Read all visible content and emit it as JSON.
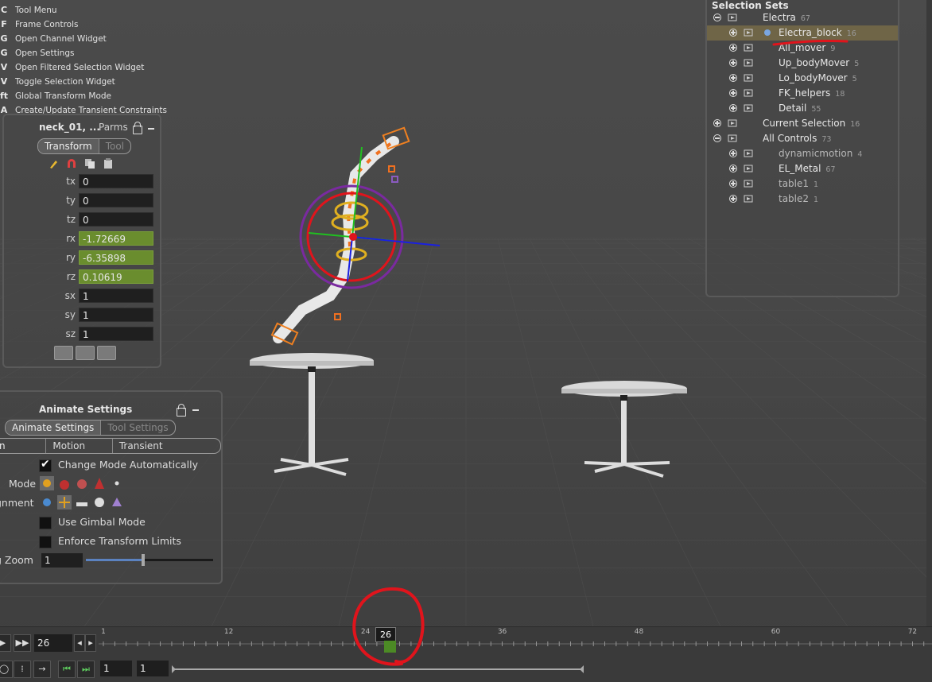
{
  "hotkeys": [
    {
      "key": "C",
      "label": "Tool Menu"
    },
    {
      "key": "F",
      "label": "Frame Controls"
    },
    {
      "key": "G",
      "label": "Open Channel Widget"
    },
    {
      "key": "G",
      "label": "Open Settings"
    },
    {
      "key": "V",
      "label": "Open Filtered Selection Widget"
    },
    {
      "key": "V",
      "label": "Toggle Selection Widget"
    },
    {
      "key": "ft",
      "label": "Global Transform Mode"
    },
    {
      "key": "A",
      "label": "Create/Update Transient Constraints"
    }
  ],
  "parms": {
    "title": "neck_01, ...",
    "subtitle": "Parms",
    "tabs": [
      "Transform",
      "Tool"
    ],
    "fields": [
      {
        "label": "tx",
        "value": "0",
        "keyed": false
      },
      {
        "label": "ty",
        "value": "0",
        "keyed": false
      },
      {
        "label": "tz",
        "value": "0",
        "keyed": false
      },
      {
        "label": "rx",
        "value": "-1.72669",
        "keyed": true
      },
      {
        "label": "ry",
        "value": "-6.35898",
        "keyed": true
      },
      {
        "label": "rz",
        "value": "0.10619",
        "keyed": true
      },
      {
        "label": "sx",
        "value": "1",
        "keyed": false
      },
      {
        "label": "sy",
        "value": "1",
        "keyed": false
      },
      {
        "label": "sz",
        "value": "1",
        "keyed": false
      }
    ]
  },
  "animate": {
    "title": "Animate Settings",
    "tabs": [
      "Animate Settings",
      "Tool Settings"
    ],
    "subtabs": [
      "n Handle",
      "Motion Path",
      "Transient Constraints"
    ],
    "change_mode": "Change Mode Automatically",
    "mode_label": "Mode",
    "alignment_label": "gnment",
    "gimbal": "Use Gimbal Mode",
    "limits": "Enforce Transform Limits",
    "zoom_label": "g Zoom",
    "zoom_value": "1",
    "zoom_slider_fraction": 0.45
  },
  "selection_sets": {
    "title": "Selection Sets",
    "rows": [
      {
        "name": "Electra",
        "count": "67",
        "level": 0,
        "expanded": true
      },
      {
        "name": "Electra_block",
        "count": "16",
        "level": 1,
        "highlight": true
      },
      {
        "name": "All_mover",
        "count": "9",
        "level": 1
      },
      {
        "name": "Up_bodyMover",
        "count": "5",
        "level": 1
      },
      {
        "name": "Lo_bodyMover",
        "count": "5",
        "level": 1
      },
      {
        "name": "FK_helpers",
        "count": "18",
        "level": 1
      },
      {
        "name": "Detail",
        "count": "55",
        "level": 1
      },
      {
        "name": "Current Selection",
        "count": "16",
        "level": 0
      },
      {
        "name": "All Controls",
        "count": "73",
        "level": 0,
        "expanded": true
      },
      {
        "name": "dynamicmotion",
        "count": "4",
        "level": 1,
        "dim": true
      },
      {
        "name": "EL_Metal",
        "count": "67",
        "level": 1
      },
      {
        "name": "table1",
        "count": "1",
        "level": 1,
        "dim": true
      },
      {
        "name": "table2",
        "count": "1",
        "level": 1,
        "dim": true
      }
    ]
  },
  "timeline": {
    "current_frame": "26",
    "frame_field": "26",
    "ruler_labels": [
      "1",
      "12",
      "24",
      "36",
      "48",
      "60",
      "72"
    ],
    "range_start": "1",
    "range_end": "1"
  },
  "colors": {
    "keyed_field": "#6a8d2e",
    "highlight_row": "#6f6547",
    "annotation_red": "#e0141c"
  }
}
